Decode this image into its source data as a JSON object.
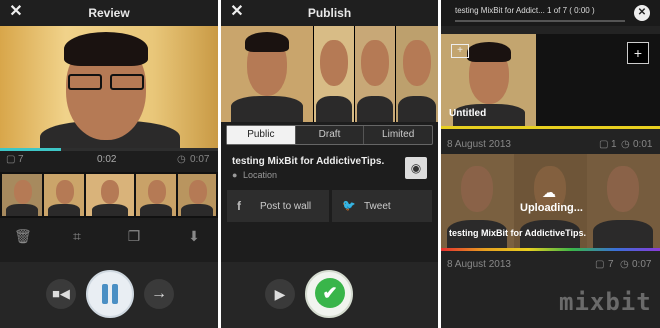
{
  "review": {
    "title": "Review",
    "clip_count": "7",
    "current_time": "0:02",
    "total_time": "0:07",
    "progress": 0.28,
    "accent_color": "#3ec6c6"
  },
  "publish": {
    "title": "Publish",
    "tabs": [
      "Public",
      "Draft",
      "Limited"
    ],
    "active_tab": "Public",
    "video_title": "testing MixBit for AddictiveTips.",
    "location_label": "Location",
    "share_facebook": "Post to wall",
    "share_twitter": "Tweet"
  },
  "library": {
    "upload_status": "testing MixBit for Addict... 1 of 7 ( 0:00 )",
    "item1": {
      "title": "Untitled",
      "date": "8 August 2013",
      "clips": "1",
      "duration": "0:01"
    },
    "item2": {
      "overlay": "Uploading...",
      "title": "testing MixBit for AddictiveTips.",
      "date": "8 August 2013",
      "clips": "7",
      "duration": "0:07"
    },
    "brand": "mixbit"
  },
  "colors": {
    "teal": "#3ec6c6",
    "yellow": "#e8d020",
    "green": "#39b54a"
  }
}
